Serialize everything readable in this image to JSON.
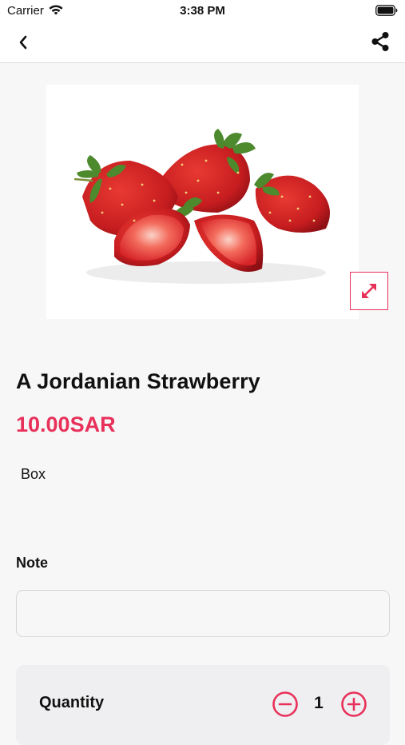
{
  "status_bar": {
    "carrier": "Carrier",
    "time": "3:38 PM"
  },
  "nav": {
    "back_icon": "chevron-left-icon",
    "share_icon": "share-icon"
  },
  "product": {
    "image_icon": "strawberries-image",
    "expand_icon": "expand-arrows-icon",
    "title": "A Jordanian Strawberry",
    "price": "10.00SAR",
    "unit": "Box"
  },
  "note": {
    "label": "Note",
    "value": "",
    "placeholder": ""
  },
  "quantity": {
    "label": "Quantity",
    "value": "1",
    "minus_icon": "minus-circle-icon",
    "plus_icon": "plus-circle-icon"
  },
  "colors": {
    "accent": "#e8315a",
    "background": "#f7f7f8",
    "card": "#efeff1"
  }
}
